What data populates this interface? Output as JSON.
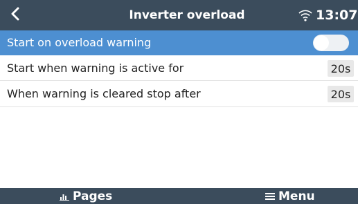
{
  "header": {
    "title": "Inverter overload",
    "time": "13:07"
  },
  "settings": [
    {
      "label": "Start on overload warning",
      "toggle_on": false,
      "selected": true
    },
    {
      "label": "Start when warning is active for",
      "value": "20s"
    },
    {
      "label": "When warning is cleared stop after",
      "value": "20s"
    }
  ],
  "footer": {
    "pages_label": "Pages",
    "menu_label": "Menu"
  },
  "colors": {
    "header_bg": "#3b4c5c",
    "selected_row": "#4d8fd1",
    "value_box": "#e8e8e8"
  },
  "icons": {
    "back": "chevron-left-icon",
    "wifi": "wifi-icon",
    "pages": "bar-chart-icon",
    "menu": "hamburger-icon"
  }
}
